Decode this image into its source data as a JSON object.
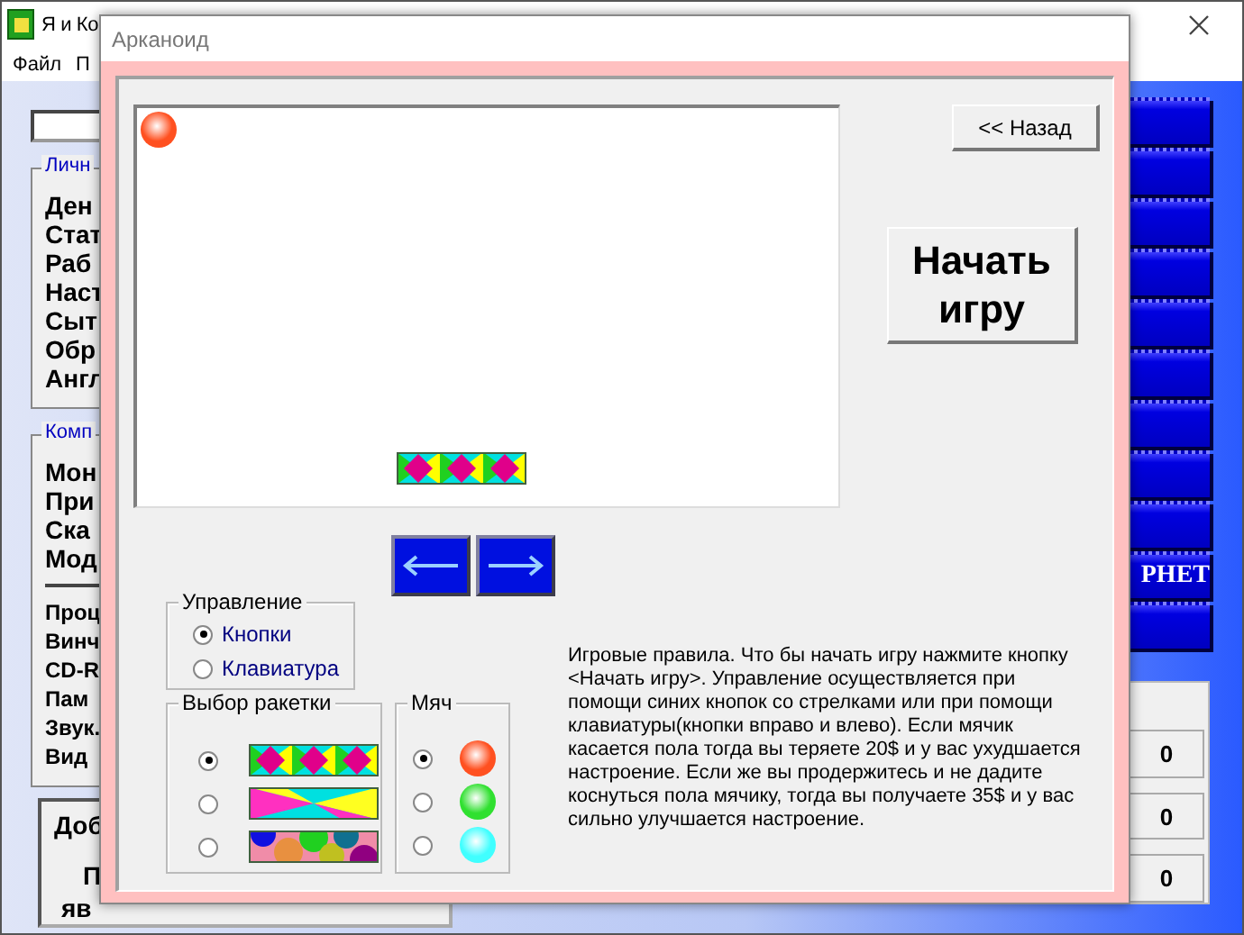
{
  "main_window": {
    "title": "Я и Ко",
    "menu": [
      "Файл",
      "П"
    ],
    "personal_group": {
      "title": "Личн",
      "items": [
        "Ден",
        "Стат",
        "Раб",
        "Наст",
        "Сыт",
        "Обр",
        "Англ"
      ]
    },
    "computer_group": {
      "title": "Комп",
      "items": [
        "Мон",
        "При",
        "Ска",
        "Мод"
      ],
      "specs": [
        "Проц",
        "Винч",
        "CD-R",
        "Пам",
        "Звук.",
        "Вид"
      ]
    },
    "message_panel": {
      "lines": [
        "Доб",
        "П",
        "яв"
      ]
    },
    "side_label": "РНЕТ",
    "counters": [
      "0",
      "0",
      "0"
    ]
  },
  "dialog": {
    "title": "Арканоид",
    "back_button": "<< Назад",
    "start_button": "Начать игру",
    "control": {
      "title": "Управление",
      "options": [
        {
          "label": "Кнопки",
          "selected": true
        },
        {
          "label": "Клавиатура",
          "selected": false
        }
      ]
    },
    "paddle_choice": {
      "title": "Выбор ракетки",
      "options": [
        {
          "kind": "diamonds",
          "selected": true
        },
        {
          "kind": "rays",
          "selected": false
        },
        {
          "kind": "circles",
          "selected": false
        }
      ]
    },
    "ball_choice": {
      "title": "Мяч",
      "options": [
        {
          "color": "#ff5020",
          "selected": true
        },
        {
          "color": "#30e030",
          "selected": false
        },
        {
          "color": "#40ffff",
          "selected": false
        }
      ]
    },
    "rules": "Игровые правила. Что бы начать игру нажмите кнопку <Начать игру>. Управление осуществляется при помощи синих кнопок со стрелками или при помощи клавиатуры(кнопки вправо и влево). Если мячик касается пола тогда вы теряете 20$ и у вас ухудшается настроение. Если же вы продержитесь и не дадите коснуться пола мячику, тогда вы получаете 35$ и у вас сильно улучшается настроение."
  }
}
